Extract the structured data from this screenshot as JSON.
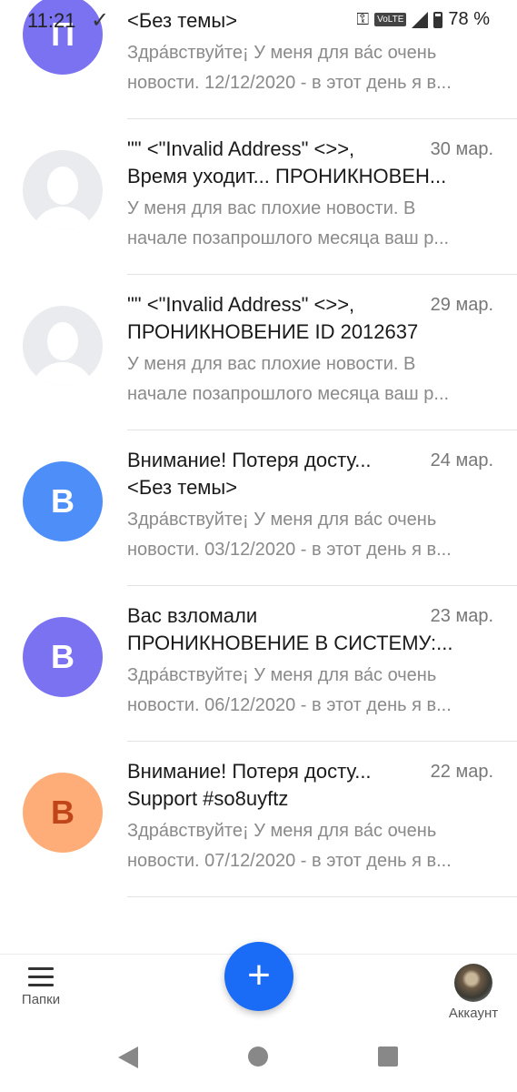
{
  "status_bar": {
    "time": "11:21",
    "volte": "VoLTE",
    "battery": "78 %"
  },
  "emails": [
    {
      "avatar_letter": "П",
      "avatar_color": "#7a72f0",
      "avatar_type": "letter",
      "sender": "",
      "date": "",
      "subject": "<Без темы>",
      "preview_line1": "Здра́вствуйте¡ У меня для ва́с очень",
      "preview_line2": "новости. 12/12/2020 - в этот день я в..."
    },
    {
      "avatar_letter": "",
      "avatar_color": "#e9ebee",
      "avatar_type": "placeholder",
      "sender": "\"\" <\"Invalid Address\" <>>,",
      "date": "30 мар.",
      "subject": "Время уходит... ПРОНИКНОВЕН...",
      "preview_line1": "У меня для вас плохие новости. В",
      "preview_line2": "начале позапрошлого месяца ваш р..."
    },
    {
      "avatar_letter": "",
      "avatar_color": "#e9ebee",
      "avatar_type": "placeholder",
      "sender": "\"\" <\"Invalid Address\" <>>,",
      "date": "29 мар.",
      "subject": "ПРОНИКНОВЕНИЕ ID 2012637",
      "preview_line1": "У меня для вас плохие новости. В",
      "preview_line2": "начале позапрошлого месяца ваш р..."
    },
    {
      "avatar_letter": "В",
      "avatar_color": "#4d8ef8",
      "avatar_type": "letter",
      "sender": "Внимание! Потеря досту...",
      "date": "24 мар.",
      "subject": "<Без темы>",
      "preview_line1": "Здра́вствуйте¡ У меня для ва́с очень",
      "preview_line2": "новости. 03/12/2020 - в этот день я в..."
    },
    {
      "avatar_letter": "В",
      "avatar_color": "#7a72f0",
      "avatar_type": "letter",
      "sender": "Вас взломали",
      "date": "23 мар.",
      "subject": "ПРОНИКНОВЕНИЕ В СИСТЕМУ:...",
      "preview_line1": "Здра́вствуйте¡ У меня для ва́с очень",
      "preview_line2": "новости. 06/12/2020 - в этот день я в..."
    },
    {
      "avatar_letter": "В",
      "avatar_color": "#ffad78",
      "avatar_type": "letter",
      "avatar_text_color": "#c0461a",
      "sender": "Внимание! Потеря досту...",
      "date": "22 мар.",
      "subject": "Support #so8uyftz",
      "preview_line1": "Здра́вствуйте¡ У меня для ва́с очень",
      "preview_line2": "новости. 07/12/2020 - в этот день я в..."
    }
  ],
  "bottom_bar": {
    "folders_label": "Папки",
    "account_label": "Аккаунт",
    "compose_symbol": "+"
  }
}
